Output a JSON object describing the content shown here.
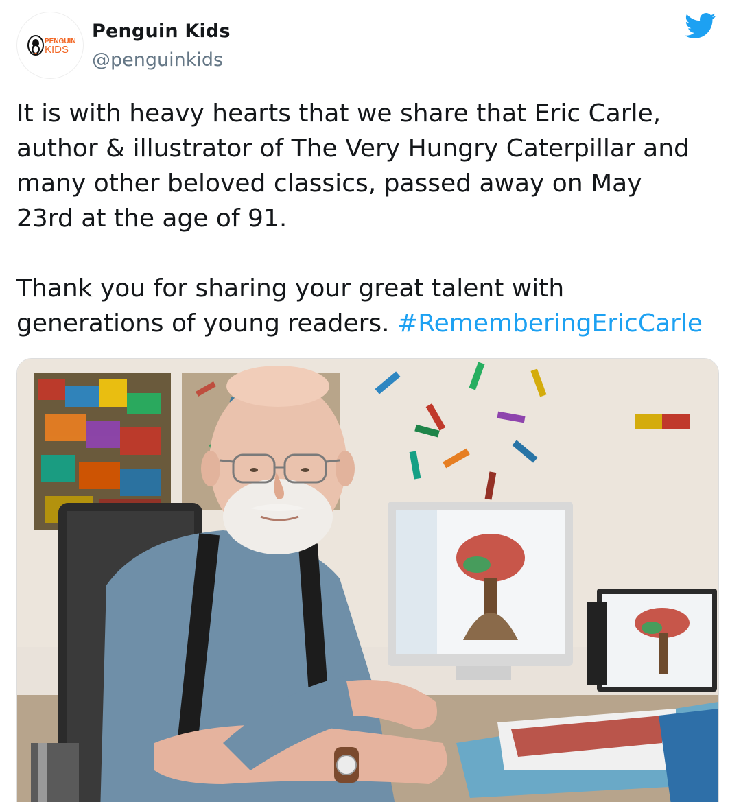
{
  "account": {
    "display_name": "Penguin Kids",
    "handle": "@penguinkids",
    "avatar_logo_text_top": "PENGUIN",
    "avatar_logo_text_bottom": "KIDS"
  },
  "tweet": {
    "paragraph_1": "It is with heavy hearts that we share that Eric Carle,\nauthor & illustrator of The Very Hungry Caterpillar and\nmany other beloved classics, passed away on May\n23rd at the age of 91.",
    "paragraph_2_text": "Thank you for sharing your great talent with\ngenerations of young readers. ",
    "hashtag": "#RememberingEricCarle"
  },
  "icons": {
    "brand": "twitter-bird-icon",
    "avatar": "penguin-logo-icon"
  },
  "colors": {
    "brand_blue": "#1da1f2",
    "text": "#14171a",
    "muted": "#657786",
    "penguin_orange": "#f26522"
  }
}
